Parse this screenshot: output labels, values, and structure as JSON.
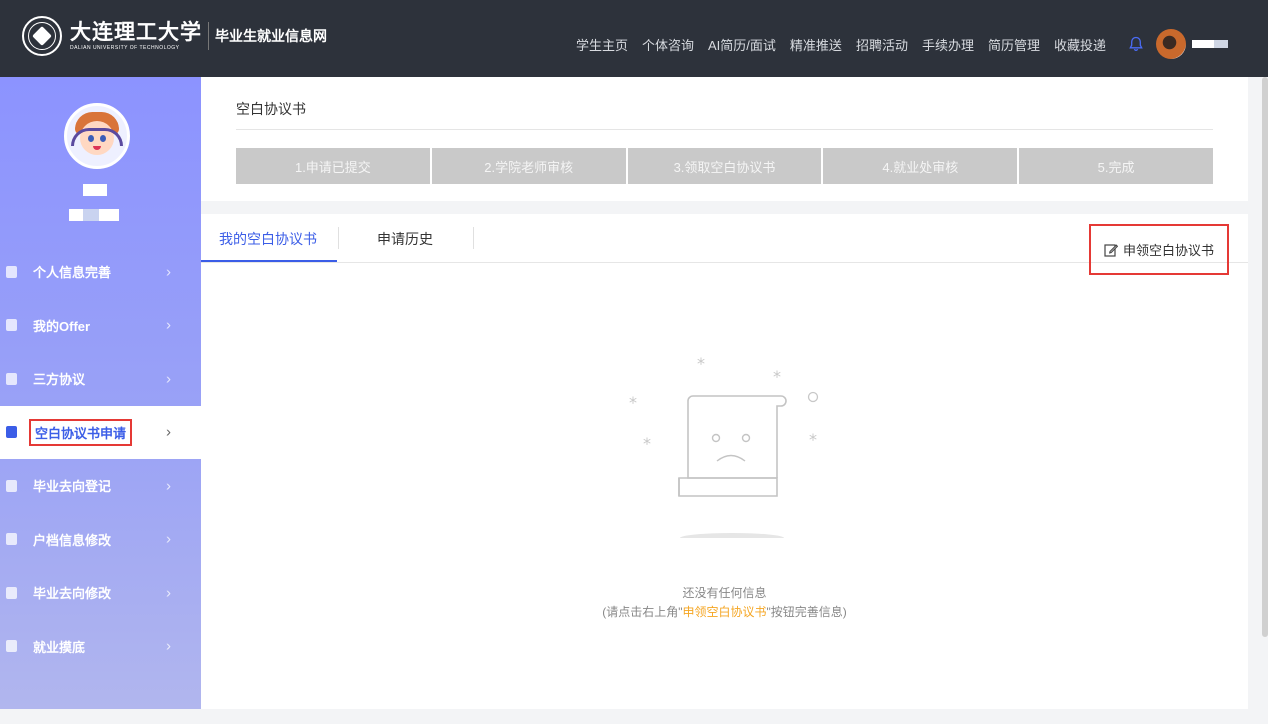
{
  "header": {
    "logo_cn": "大连理工大学",
    "logo_en": "DALIAN UNIVERSITY OF TECHNOLOGY",
    "site_name": "毕业生就业信息网",
    "nav": [
      "学生主页",
      "个体咨询",
      "AI简历/面试",
      "精准推送",
      "招聘活动",
      "手续办理",
      "简历管理",
      "收藏投递"
    ],
    "bell_icon": "bell-icon",
    "avatar_icon": "user-avatar"
  },
  "sidebar": {
    "menu": [
      {
        "label": "个人信息完善",
        "icon": "user-icon"
      },
      {
        "label": "我的Offer",
        "icon": "document-icon"
      },
      {
        "label": "三方协议",
        "icon": "document-icon"
      },
      {
        "label": "空白协议书申请",
        "icon": "clipboard-icon",
        "active": true
      },
      {
        "label": "毕业去向登记",
        "icon": "document-icon"
      },
      {
        "label": "户档信息修改",
        "icon": "car-icon"
      },
      {
        "label": "毕业去向修改",
        "icon": "car-icon"
      },
      {
        "label": "就业摸底",
        "icon": "document-icon"
      }
    ]
  },
  "process": {
    "title": "空白协议书",
    "steps": [
      "1.申请已提交",
      "2.学院老师审核",
      "3.领取空白协议书",
      "4.就业处审核",
      "5.完成"
    ]
  },
  "tabs": {
    "my_agreement": "我的空白协议书",
    "history": "申请历史"
  },
  "apply_button": "申领空白协议书",
  "empty": {
    "line1": "还没有任何信息",
    "line2_prefix": "(请点击右上角\"",
    "line2_highlight": "申领空白协议书",
    "line2_suffix": "\"按钮完善信息)"
  },
  "colors": {
    "accent": "#3b5de7",
    "highlight": "#f5a623",
    "annotation": "#e53935",
    "topbar": "#2d323b"
  }
}
